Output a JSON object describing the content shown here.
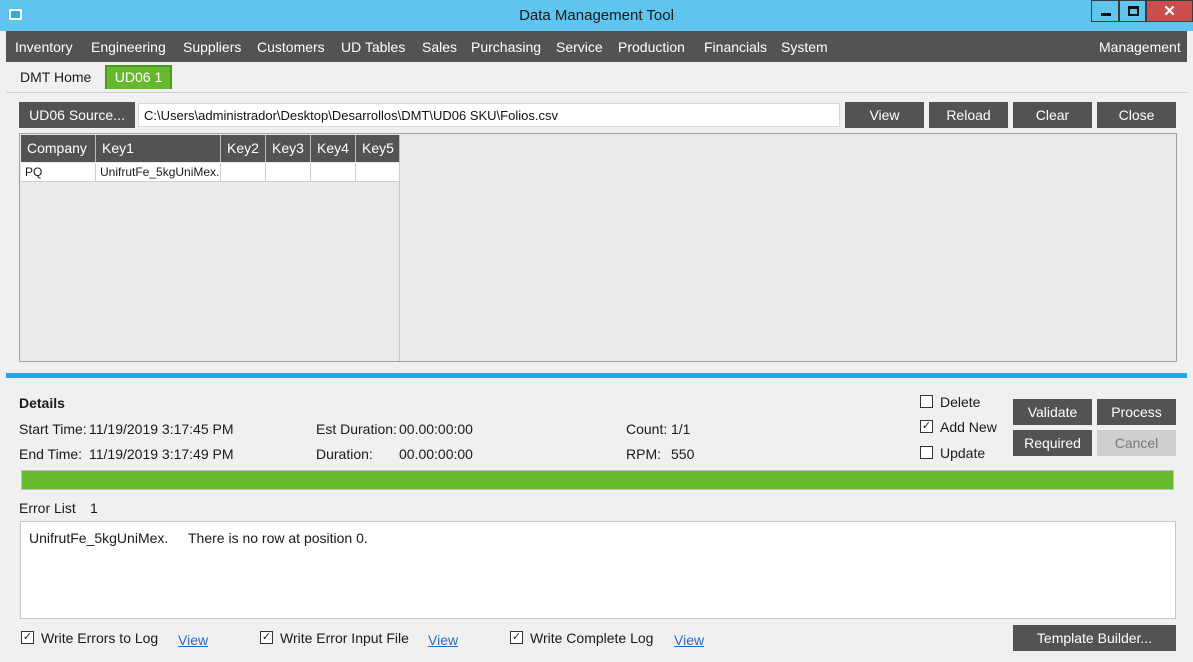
{
  "window": {
    "title": "Data Management Tool",
    "min_label": "",
    "max_label": "",
    "close_label": "✕"
  },
  "menu": {
    "items": [
      "Inventory",
      "Engineering",
      "Suppliers",
      "Customers",
      "UD Tables",
      "Sales",
      "Purchasing",
      "Service",
      "Production",
      "Financials",
      "System"
    ],
    "right_item": "Management"
  },
  "tabs": {
    "home": "DMT Home",
    "active": "UD06 1"
  },
  "source": {
    "button_label": "UD06 Source...",
    "path_value": "C:\\Users\\administrador\\Desktop\\Desarrollos\\DMT\\UD06 SKU\\Folios.csv",
    "view_label": "View",
    "reload_label": "Reload",
    "clear_label": "Clear",
    "close_label": "Close"
  },
  "grid": {
    "columns": [
      "Company",
      "Key1",
      "Key2",
      "Key3",
      "Key4",
      "Key5"
    ],
    "rows": [
      [
        "PQ",
        "UnifrutFe_5kgUniMex.",
        "",
        "",
        "",
        ""
      ]
    ]
  },
  "details": {
    "heading": "Details",
    "start_time_label": "Start Time:",
    "start_time_value": "11/19/2019 3:17:45 PM",
    "end_time_label": "End Time:",
    "end_time_value": "11/19/2019 3:17:49 PM",
    "est_duration_label": "Est Duration:",
    "est_duration_value": "00.00:00:00",
    "duration_label": "Duration:",
    "duration_value": "00.00:00:00",
    "count_label": "Count:",
    "count_value": "1/1",
    "rpm_label": "RPM:",
    "rpm_value": "550",
    "progress_fraction": 1.0,
    "progress_color": "#66bb2d"
  },
  "options": {
    "delete_label": "Delete",
    "delete_checked": false,
    "add_new_label": "Add New",
    "add_new_checked": true,
    "update_label": "Update",
    "update_checked": false
  },
  "actions": {
    "validate_label": "Validate",
    "process_label": "Process",
    "required_label": "Required",
    "cancel_label": "Cancel"
  },
  "errors": {
    "label": "Error List",
    "count": "1",
    "entries": [
      {
        "key": "UnifrutFe_5kgUniMex.",
        "message": "There is no row at position 0."
      }
    ]
  },
  "logs": {
    "write_errors_label": "Write Errors to Log",
    "write_errors_checked": true,
    "write_errors_view": "View",
    "write_error_input_label": "Write Error Input File",
    "write_error_input_checked": true,
    "write_error_input_view": "View",
    "write_complete_label": "Write Complete Log",
    "write_complete_checked": true,
    "write_complete_view": "View"
  },
  "template_builder_label": "Template Builder...",
  "colors": {
    "titlebar": "#5fc4ee",
    "menubar": "#535353",
    "active_tab": "#66b92e",
    "divider": "#23a6e6",
    "link": "#1f6ec9"
  }
}
